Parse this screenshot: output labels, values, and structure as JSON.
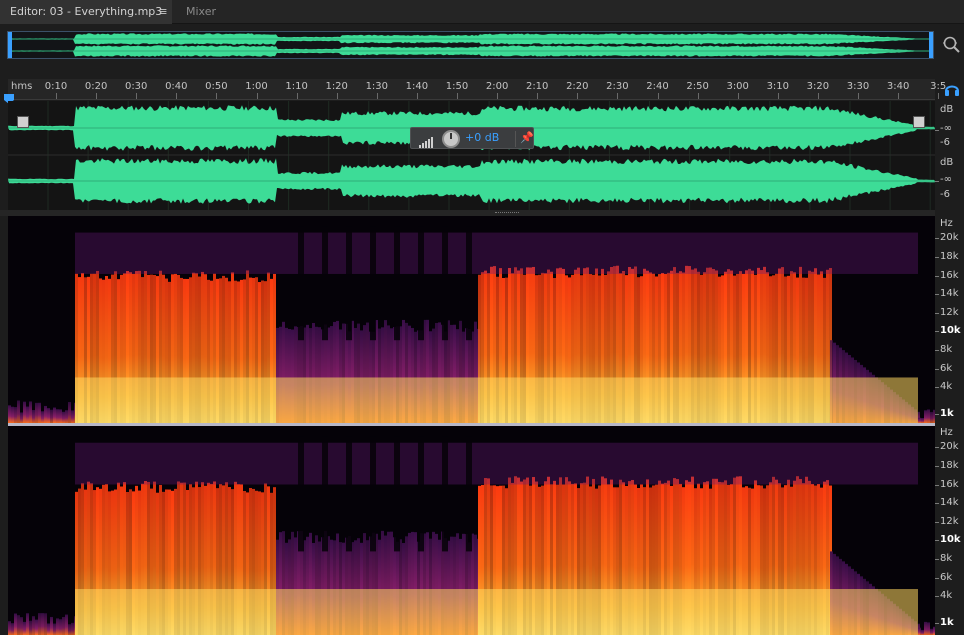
{
  "tabs": {
    "editor_label": "Editor: 03 - Everything.mp3",
    "menu_icon": "≡",
    "mixer_label": "Mixer"
  },
  "ruler": {
    "unit": "hms",
    "labels": [
      "0:10",
      "0:20",
      "0:30",
      "0:40",
      "0:50",
      "1:00",
      "1:10",
      "1:20",
      "1:30",
      "1:40",
      "1:50",
      "2:00",
      "2:10",
      "2:20",
      "2:30",
      "2:40",
      "2:50",
      "3:00",
      "3:10",
      "3:20",
      "3:30",
      "3:40",
      "3:5"
    ]
  },
  "hud": {
    "value": "+0 dB",
    "meter_icon": "volume-meter-icon",
    "knob": "volume-knob",
    "pin_icon": "pin-icon"
  },
  "amplitude_axis": {
    "top": {
      "unit": "dB",
      "inf": "-∞",
      "minus6": "-6"
    },
    "bottom": {
      "unit": "dB",
      "inf": "-∞",
      "minus6": "-6"
    }
  },
  "frequency_axis": {
    "top": [
      "Hz",
      "20k",
      "18k",
      "16k",
      "14k",
      "12k",
      "10k",
      "8k",
      "6k",
      "4k",
      "1k"
    ],
    "bottom": [
      "Hz",
      "20k",
      "18k",
      "16k",
      "14k",
      "12k",
      "10k",
      "8k",
      "6k",
      "4k",
      "1k"
    ]
  },
  "colors": {
    "waveform": "#3ddc97",
    "waveform_quiet": "#2fae78",
    "selection": "#3aa0ff",
    "spectral_hot": "#ffd860",
    "spectral_mid": "#ff5a10",
    "spectral_low": "#6a1a7a"
  },
  "icons": {
    "zoom": "zoom-icon",
    "headphones": "headphones-icon",
    "playhead": "playhead-icon"
  }
}
